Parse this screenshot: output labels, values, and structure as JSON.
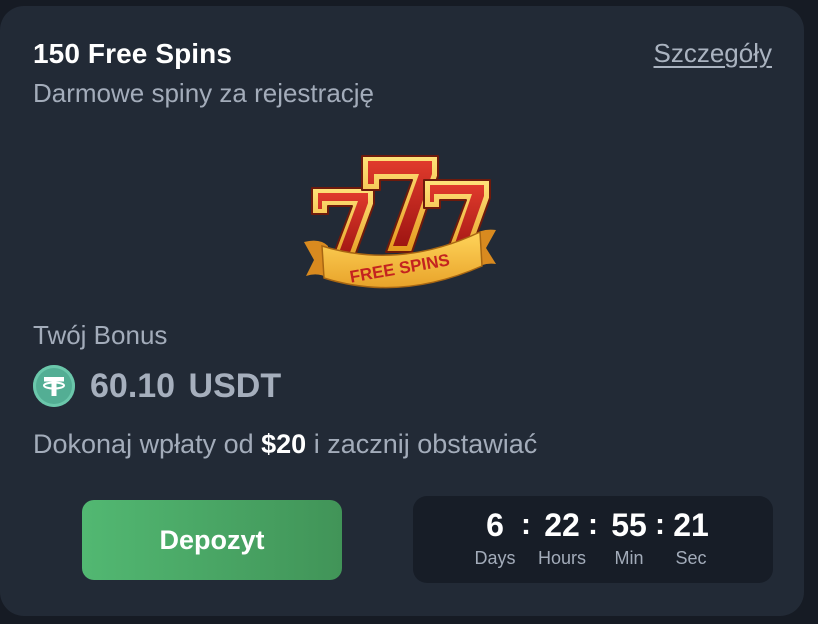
{
  "promo": {
    "title": "150 Free Spins",
    "subtitle": "Darmowe spiny za rejestrację",
    "details_link": "Szczegóły",
    "logo": {
      "digits": "777",
      "ribbon_text": "FREE SPINS"
    },
    "bonus_label": "Twój Bonus",
    "bonus_amount": "60.10 USDT",
    "currency_icon": "usdt-tether-icon",
    "deposit_text_prefix": "Dokonaj wpłaty od ",
    "deposit_min": "$20",
    "deposit_text_suffix": " i zacznij obstawiać",
    "deposit_button": "Depozyt"
  },
  "countdown": {
    "days": "6",
    "hours": "22",
    "minutes": "55",
    "seconds": "21",
    "days_label": "Days",
    "hours_label": "Hours",
    "minutes_label": "Min",
    "seconds_label": "Sec",
    "separator": ":"
  },
  "colors": {
    "card_bg": "#222a36",
    "page_bg": "#161b24",
    "button_green": "#4caa68",
    "usdt_green": "#53ae94",
    "logo_red": "#c4231f",
    "logo_gold": "#f5b630"
  }
}
